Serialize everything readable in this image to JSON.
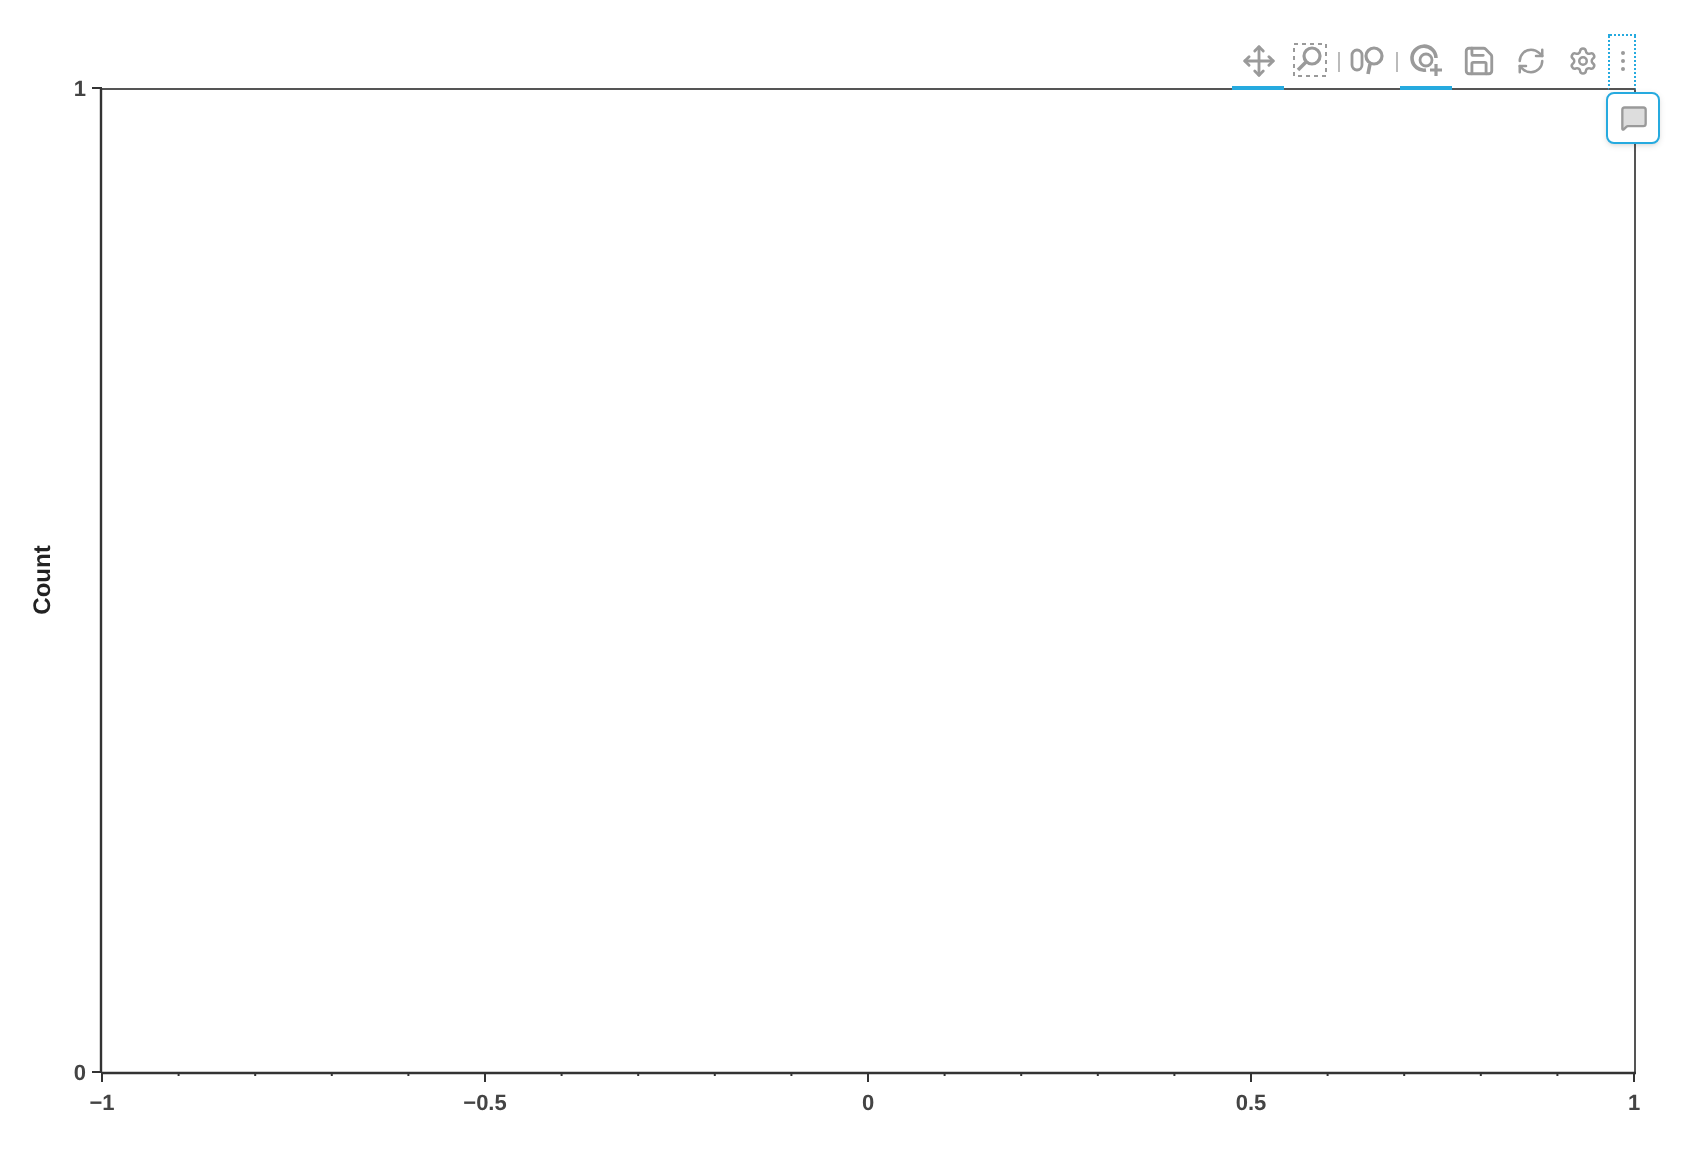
{
  "toolbar": {
    "tools": [
      {
        "kind": "pan",
        "selected": true
      },
      {
        "kind": "box_zoom",
        "selected": false
      },
      {
        "kind": "wheel_zoom",
        "selected": false
      },
      {
        "kind": "zoom_in",
        "selected": true
      },
      {
        "kind": "save",
        "selected": false
      },
      {
        "kind": "reset",
        "selected": false
      },
      {
        "kind": "settings",
        "selected": false
      },
      {
        "kind": "more",
        "selected": false
      }
    ]
  },
  "popup": {
    "kind": "hover"
  },
  "plot": {
    "chart_data": {
      "type": "bar",
      "ylabel": "Count",
      "xlim": [
        -1,
        1
      ],
      "ylim": [
        0,
        1
      ],
      "xticks": [
        {
          "value": -1,
          "label": "−1"
        },
        {
          "value": -0.5,
          "label": "−0.5"
        },
        {
          "value": 0,
          "label": "0"
        },
        {
          "value": 0.5,
          "label": "0.5"
        },
        {
          "value": 1,
          "label": "1"
        }
      ],
      "yticks": [
        0,
        1
      ]
    }
  }
}
